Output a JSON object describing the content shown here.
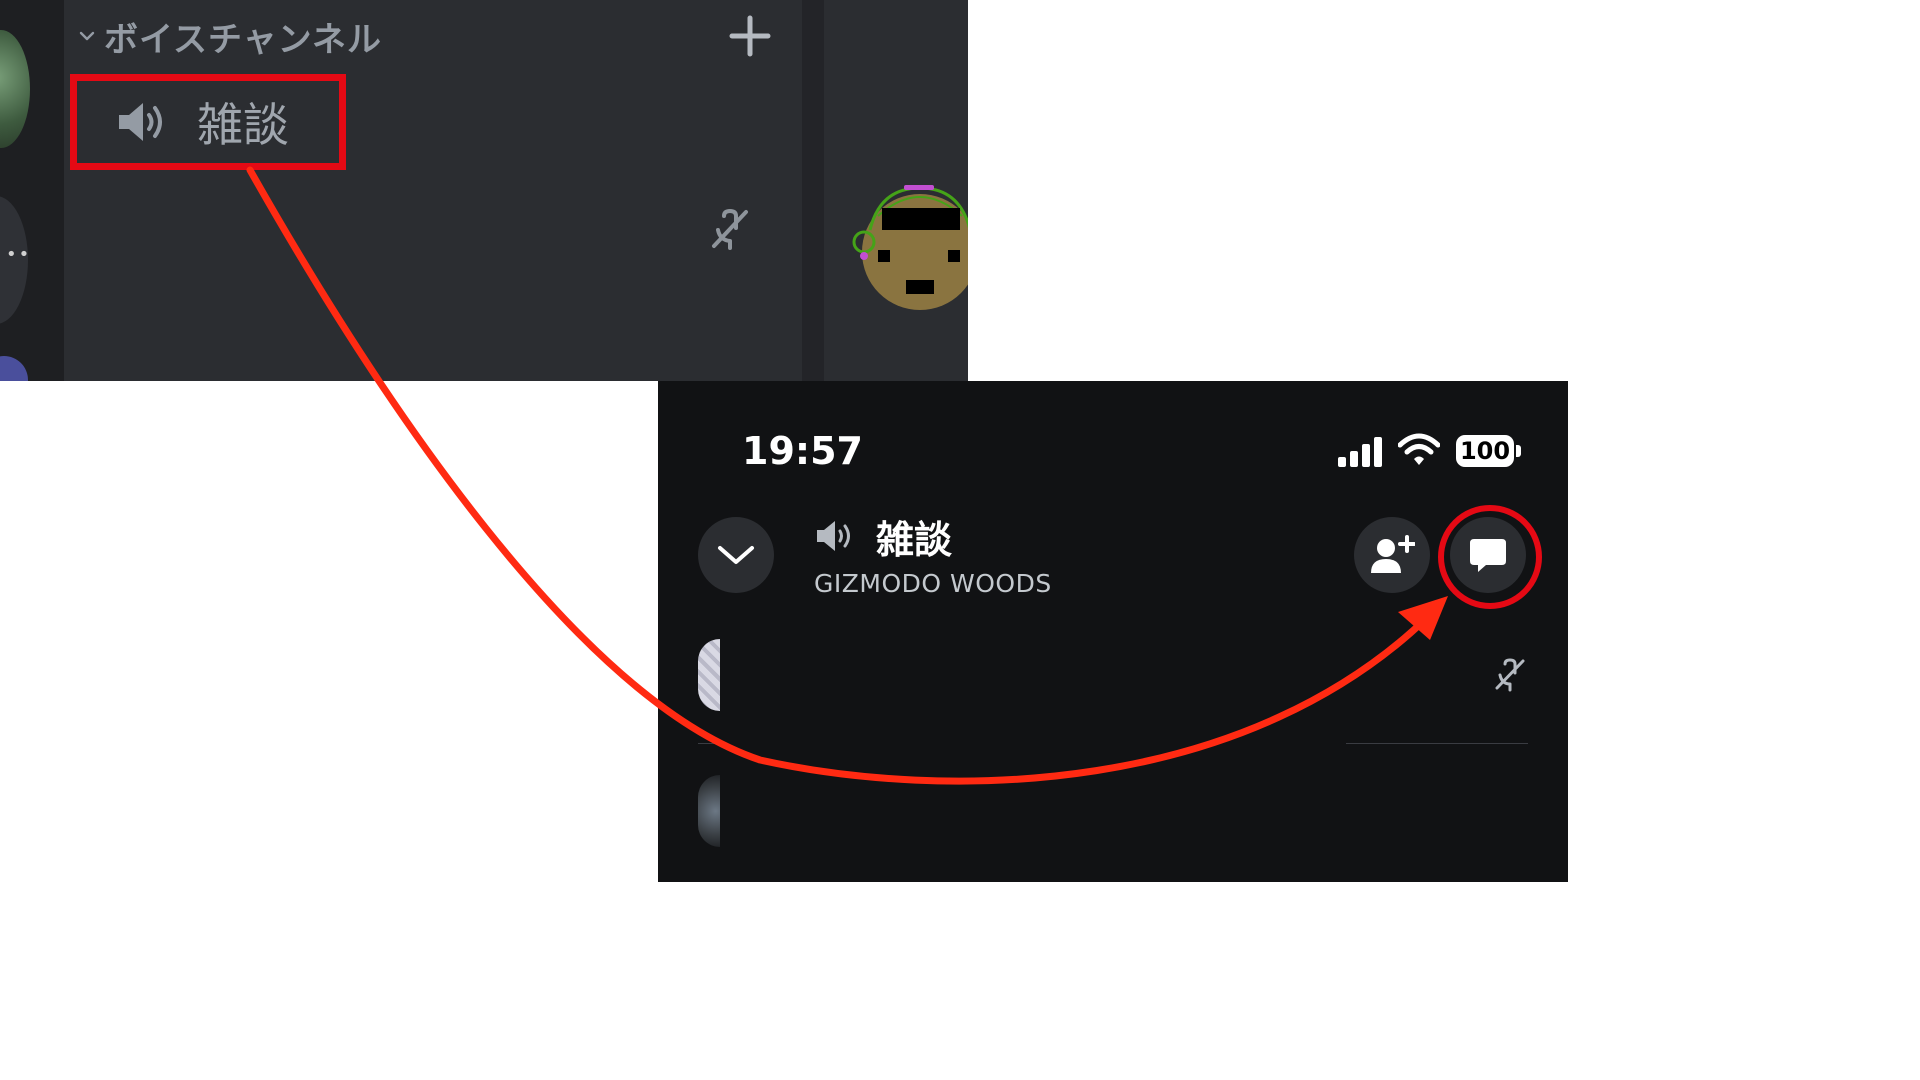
{
  "desktop": {
    "category_label": "ボイスチャンネル",
    "voice_channel_label": "雑談"
  },
  "phone": {
    "status_time": "19:57",
    "battery_level": "100",
    "channel_name": "雑談",
    "server_name": "GIZMODO WOODS"
  },
  "icons": [
    "chevron-down-icon",
    "plus-icon",
    "speaker-icon",
    "mic-muted-icon",
    "cellular-signal-icon",
    "wifi-icon",
    "battery-icon",
    "add-user-icon",
    "chat-bubble-icon",
    "curved-arrow"
  ],
  "colors": {
    "highlight_red": "#e50914",
    "desktop_bg": "#2b2d31",
    "phone_bg": "#111214"
  }
}
